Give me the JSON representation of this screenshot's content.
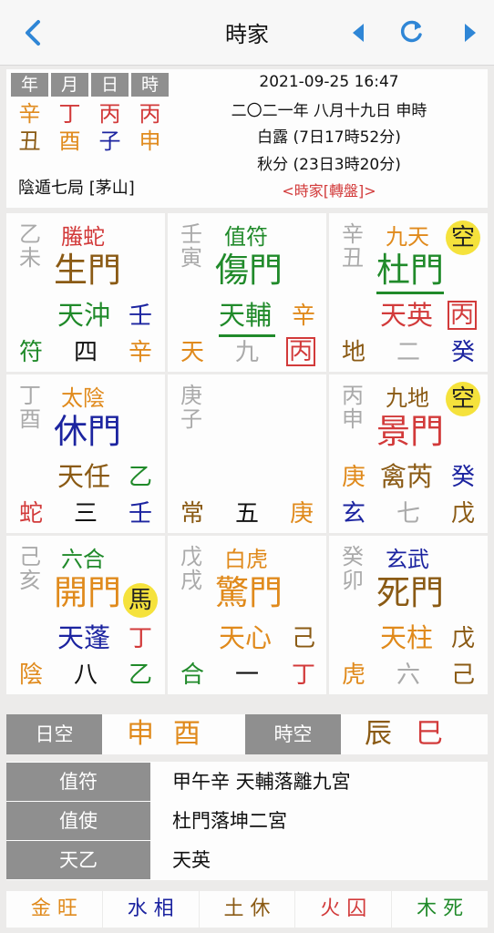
{
  "header": {
    "title": "時家",
    "back_icon": "chevron-left-icon",
    "prev_icon": "triangle-left-icon",
    "refresh_icon": "refresh-icon",
    "next_icon": "triangle-right-icon"
  },
  "info": {
    "pillar_labels": [
      "年",
      "月",
      "日",
      "時"
    ],
    "stems": [
      "辛",
      "丁",
      "丙",
      "丙"
    ],
    "branches": [
      "丑",
      "酉",
      "子",
      "申"
    ],
    "datetime": "2021-09-25 16:47",
    "lunar": "二〇二一年 八月十九日 申時",
    "term1": "白露 (7日17時52分)",
    "term2": "秋分 (23日3時20分)",
    "ju": "陰遁七局 [茅山]",
    "mode": "<時家[轉盤]>"
  },
  "palaces": {
    "p1": {
      "stem1": "乙",
      "stem2": "未",
      "god": "螣蛇",
      "door": "生門",
      "star": "天沖",
      "star_stem": "壬",
      "left": "符",
      "num": "四",
      "ground": "辛"
    },
    "p2": {
      "stem1": "壬",
      "stem2": "寅",
      "god": "值符",
      "door": "傷門",
      "star": "天輔",
      "star_stem": "辛",
      "left": "天",
      "num": "九",
      "ground": "丙"
    },
    "p3": {
      "stem1": "辛",
      "stem2": "丑",
      "god": "九天",
      "kong": "空",
      "door": "杜門",
      "star": "天英",
      "star_stem": "丙",
      "left": "地",
      "num": "二",
      "ground": "癸"
    },
    "p4": {
      "stem1": "丁",
      "stem2": "酉",
      "god": "太陰",
      "door": "休門",
      "star": "天任",
      "star_stem": "乙",
      "left": "蛇",
      "num": "三",
      "ground": "壬"
    },
    "p5": {
      "stem1": "庚",
      "stem2": "子",
      "left": "常",
      "num": "五",
      "ground": "庚"
    },
    "p6": {
      "stem1": "丙",
      "stem2": "申",
      "god": "九地",
      "kong": "空",
      "door": "景門",
      "star": "禽芮",
      "star_left": "庚",
      "star_stem": "癸",
      "left": "玄",
      "num": "七",
      "ground": "戊"
    },
    "p7": {
      "stem1": "己",
      "stem2": "亥",
      "god": "六合",
      "door": "開門",
      "horse": "馬",
      "star": "天蓬",
      "star_stem": "丁",
      "left": "陰",
      "num": "八",
      "ground": "乙"
    },
    "p8": {
      "stem1": "戊",
      "stem2": "戌",
      "god": "白虎",
      "door": "驚門",
      "star": "天心",
      "star_stem": "己",
      "left": "合",
      "num": "一",
      "ground": "丁"
    },
    "p9": {
      "stem1": "癸",
      "stem2": "卯",
      "god": "玄武",
      "door": "死門",
      "star": "天柱",
      "star_stem": "戊",
      "left": "虎",
      "num": "六",
      "ground": "己"
    }
  },
  "kong_bar": {
    "day_label": "日空",
    "day_v1": "申",
    "day_v2": "酉",
    "hour_label": "時空",
    "hour_v1": "辰",
    "hour_v2": "巳"
  },
  "details": [
    {
      "label": "值符",
      "value": "甲午辛  天輔落離九宮"
    },
    {
      "label": "值使",
      "value": "杜門落坤二宮"
    },
    {
      "label": "天乙",
      "value": "天英"
    }
  ],
  "wuxing": [
    "金 旺",
    "水 相",
    "土 休",
    "火 囚",
    "木 死"
  ],
  "colors": {
    "green": "#208a2a",
    "red": "#d23a3a",
    "orange": "#e08a1c",
    "blue": "#1c24a0",
    "brown": "#8a5a14",
    "gray": "#aaaaaa"
  }
}
